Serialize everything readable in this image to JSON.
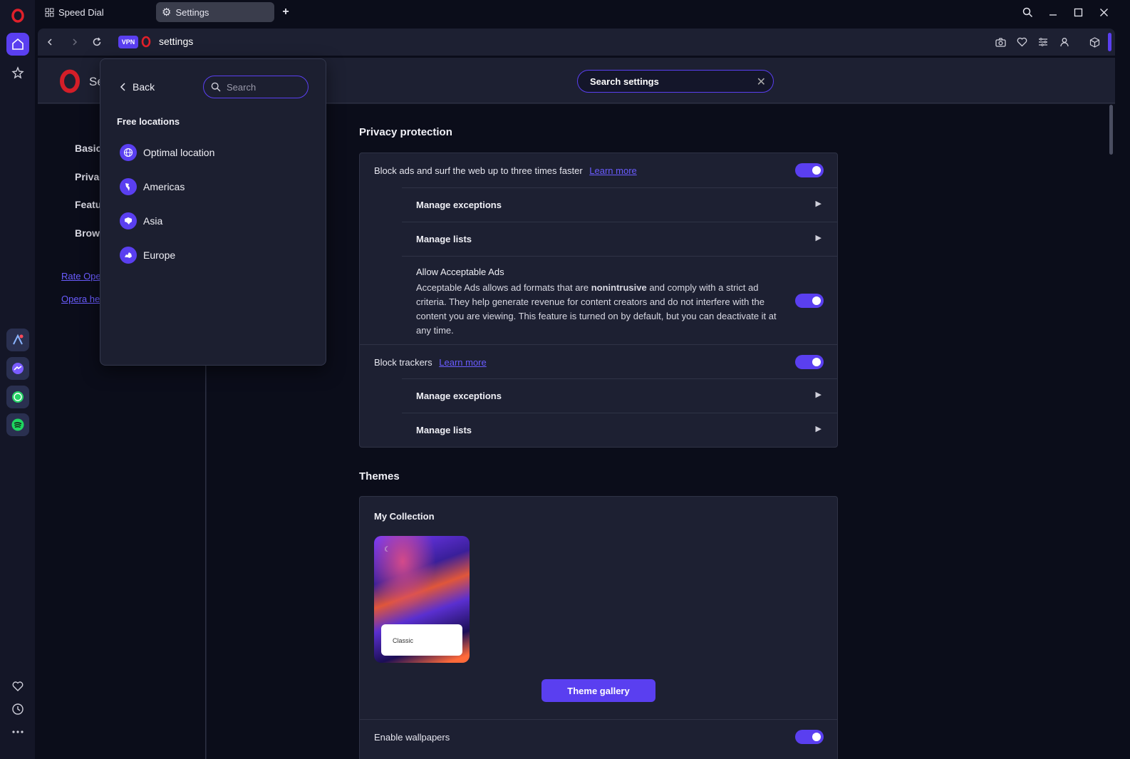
{
  "tabs": [
    {
      "label": "Speed Dial",
      "icon": "grid-icon"
    },
    {
      "label": "Settings",
      "icon": "gear-icon"
    }
  ],
  "address": {
    "vpn_label": "VPN",
    "url": "settings"
  },
  "sidebar_icons": [
    "opera-logo-icon",
    "home-icon",
    "star-icon",
    "aria-icon",
    "messenger-icon",
    "whatsapp-icon",
    "spotify-icon",
    "heart-icon",
    "history-icon",
    "more-icon"
  ],
  "header": {
    "title_partial": "Se",
    "search_value": "Search settings"
  },
  "left_nav": {
    "items": [
      "Basic",
      "Privac",
      "Featu",
      "Brows"
    ],
    "links": [
      "Rate Ope",
      "Opera he"
    ]
  },
  "vpn_popup": {
    "back_label": "Back",
    "search_placeholder": "Search",
    "section_title": "Free locations",
    "locations": [
      "Optimal location",
      "Americas",
      "Asia",
      "Europe"
    ]
  },
  "privacy": {
    "title": "Privacy protection",
    "block_ads_label": "Block ads and surf the web up to three times faster",
    "learn_more": "Learn more",
    "manage_exceptions": "Manage exceptions",
    "manage_lists": "Manage lists",
    "acceptable_ads_title": "Allow Acceptable Ads",
    "acceptable_ads_desc_1": "Acceptable Ads allows ad formats that are ",
    "acceptable_ads_bold": "nonintrusive",
    "acceptable_ads_desc_2": " and comply with a strict ad criteria. They help generate revenue for content creators and do not interfere with the content you are viewing. This feature is turned on by default, but you can deactivate it at any time.",
    "block_trackers_label": "Block trackers",
    "block_ads_enabled": true,
    "acceptable_ads_enabled": true,
    "block_trackers_enabled": true
  },
  "themes": {
    "title": "Themes",
    "collection_title": "My Collection",
    "theme_name": "Classic",
    "gallery_button": "Theme gallery",
    "wallpapers_label": "Enable wallpapers",
    "wallpapers_enabled": true
  },
  "colors": {
    "accent": "#5a3ff0",
    "background": "#0b0d1a",
    "panel": "#1d2032"
  }
}
